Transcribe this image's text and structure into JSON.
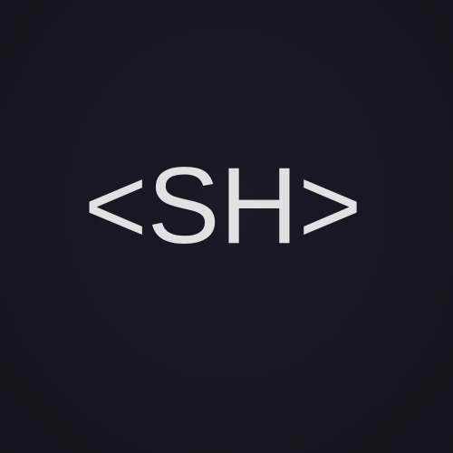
{
  "logo": {
    "text": "<SH>",
    "color": "#e1e1e3",
    "background": "#161621"
  }
}
